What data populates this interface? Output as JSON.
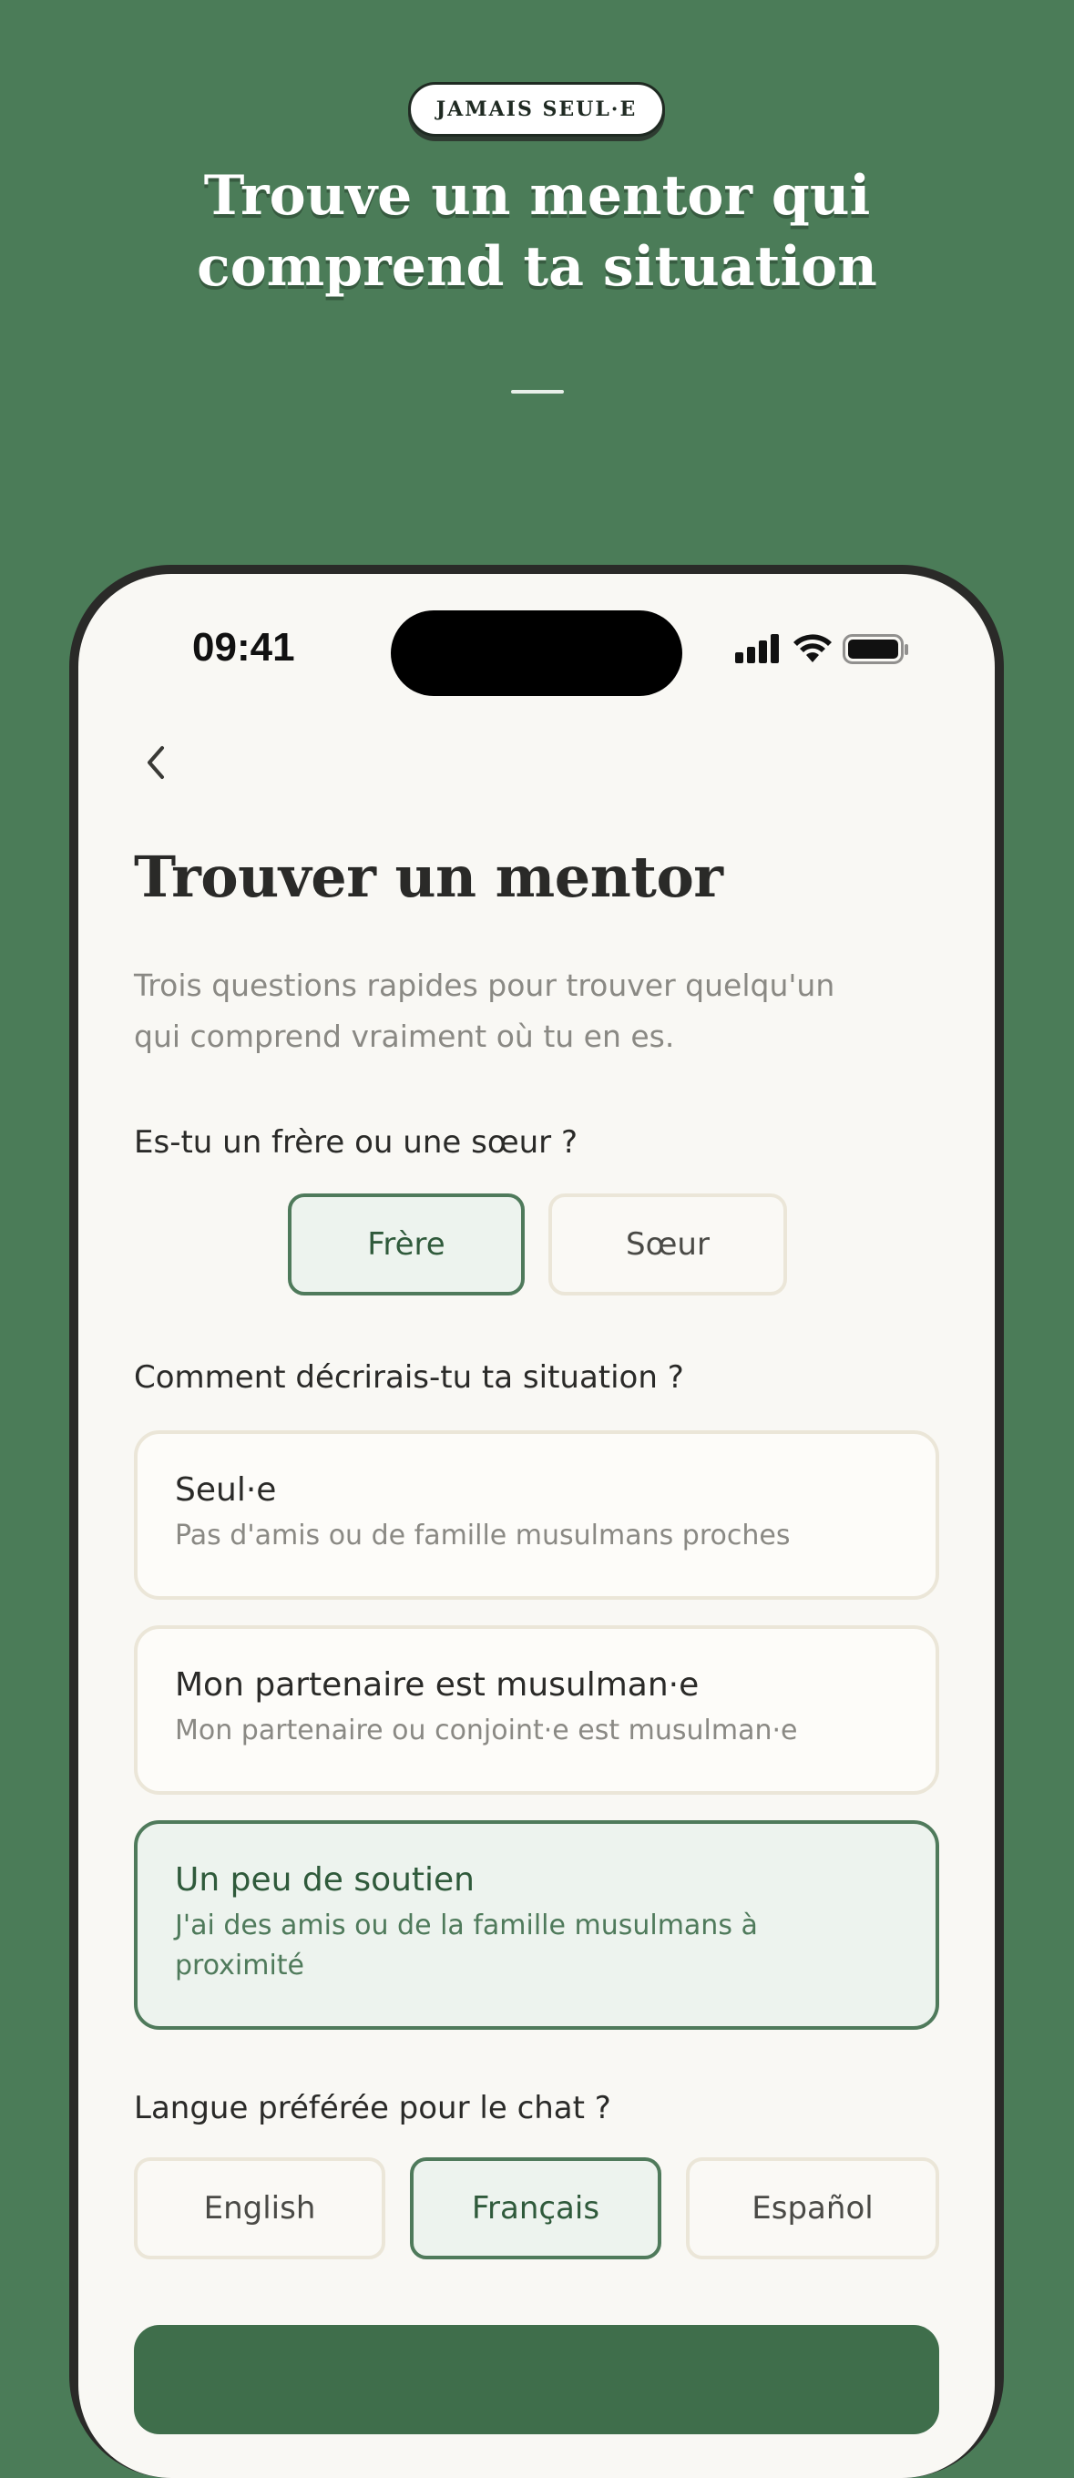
{
  "promo": {
    "badge": "JAMAIS SEUL·E",
    "headline_line1": "Trouve un mentor qui",
    "headline_line2": "comprend ta situation"
  },
  "status_bar": {
    "time": "09:41",
    "icons": [
      "signal-icon",
      "wifi-icon",
      "battery-icon"
    ]
  },
  "screen": {
    "title": "Trouver un mentor",
    "subtitle_line1": "Trois questions rapides pour trouver quelqu'un",
    "subtitle_line2": "qui comprend vraiment où tu en es.",
    "q1": {
      "label": "Es-tu un frère ou une sœur ?",
      "options": [
        "Frère",
        "Sœur"
      ],
      "selected": "Frère"
    },
    "q2": {
      "label": "Comment décrirais-tu ta situation ?",
      "options": [
        {
          "title": "Seul·e",
          "desc": "Pas d'amis ou de famille musulmans proches"
        },
        {
          "title": "Mon partenaire est musulman·e",
          "desc": "Mon partenaire ou conjoint·e est musulman·e"
        },
        {
          "title": "Un peu de soutien",
          "desc_line1": "J'ai des amis ou de la famille musulmans à",
          "desc_line2": "proximité"
        }
      ],
      "selected": "Un peu de soutien"
    },
    "q3": {
      "label": "Langue préférée pour le chat ?",
      "options": [
        "English",
        "Français",
        "Español"
      ],
      "selected": "Français"
    }
  },
  "colors": {
    "background": "#4b7c58",
    "accent": "#4f7a5b",
    "selected_fill": "#edf3ee",
    "screen_bg": "#f9f8f4"
  }
}
